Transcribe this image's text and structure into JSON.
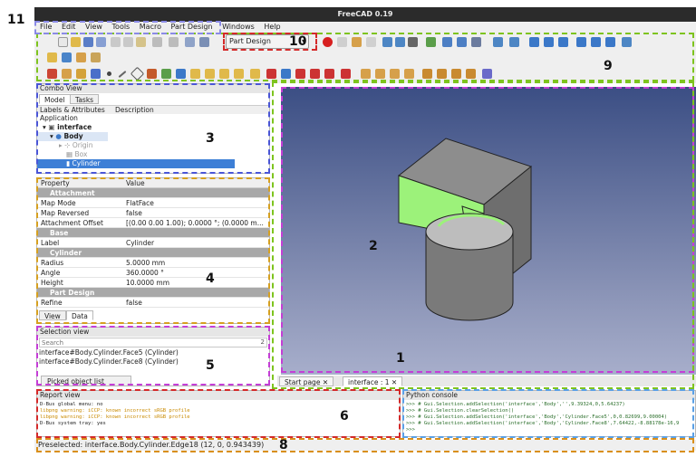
{
  "app_title": "FreeCAD 0.19",
  "menu": [
    "File",
    "Edit",
    "View",
    "Tools",
    "Macro",
    "Part Design",
    "Windows",
    "Help"
  ],
  "workbench": {
    "label": "Part Design"
  },
  "combo_view": {
    "title": "Combo View",
    "tabs": [
      "Model",
      "Tasks"
    ],
    "columns": [
      "Labels & Attributes",
      "Description"
    ],
    "tree": [
      {
        "label": "Application",
        "level": 0
      },
      {
        "label": "interface",
        "level": 1
      },
      {
        "label": "Body",
        "level": 2
      },
      {
        "label": "Origin",
        "level": 3
      },
      {
        "label": "Box",
        "level": 3
      },
      {
        "label": "Cylinder",
        "level": 3
      }
    ]
  },
  "property_view": {
    "headers": [
      "Property",
      "Value"
    ],
    "rows": [
      {
        "type": "group",
        "name": "Attachment"
      },
      {
        "name": "Map Mode",
        "value": "FlatFace"
      },
      {
        "name": "Map Reversed",
        "value": "false"
      },
      {
        "name": "Attachment Offset",
        "value": "[(0.00 0.00 1.00); 0.0000 °; (0.0000 m..."
      },
      {
        "type": "group",
        "name": "Base"
      },
      {
        "name": "Label",
        "value": "Cylinder"
      },
      {
        "type": "group",
        "name": "Cylinder"
      },
      {
        "name": "Radius",
        "value": "5.0000 mm"
      },
      {
        "name": "Angle",
        "value": "360.0000 °"
      },
      {
        "name": "Height",
        "value": "10.0000 mm"
      },
      {
        "type": "group",
        "name": "Part Design"
      },
      {
        "name": "Refine",
        "value": "false"
      }
    ],
    "tabs": [
      "View",
      "Data"
    ]
  },
  "selection_view": {
    "title": "Selection view",
    "search_placeholder": "Search",
    "count": "2",
    "items": [
      "interface#Body.Cylinder.Face5 (Cylinder)",
      "interface#Body.Cylinder.Face8 (Cylinder)"
    ],
    "picked_button": "Picked object list"
  },
  "doc_tabs": [
    "Start page",
    "interface : 1"
  ],
  "report_view": {
    "title": "Report view",
    "lines": [
      {
        "text": "D-Bus global menu: no",
        "color": "#222222"
      },
      {
        "text": "libpng warning: iCCP: known incorrect sRGB profile",
        "color": "#c98a00"
      },
      {
        "text": "libpng warning: iCCP: known incorrect sRGB profile",
        "color": "#c98a00"
      },
      {
        "text": "D-Bus system tray: yes",
        "color": "#222222"
      }
    ]
  },
  "python_console": {
    "title": "Python console",
    "lines": [
      ">>> # Gui.Selection.addSelection('interface','Body','',9.39324,0,5.64237)",
      ">>> # Gui.Selection.clearSelection()",
      ">>> # Gui.Selection.addSelection('interface','Body','Cylinder.Face5',0,0.82699,9.00004)",
      ">>> # Gui.Selection.addSelection('interface','Body','Cylinder.Face8',7.64422,-8.88178e-16,9",
      ">>>"
    ]
  },
  "status_bar": "Preselected: interface.Body.Cylinder.Edge18 (12, 0, 0.943439)",
  "annotations": [
    "1",
    "2",
    "3",
    "4",
    "5",
    "6",
    "8",
    "9",
    "10",
    "11"
  ],
  "colors": {
    "selection_green": "#9cf27a",
    "tree_selected": "#3d7fd6",
    "viewport_top": "#3b4e84",
    "viewport_bottom": "#a7aecb",
    "annot_blue": "#4a55d6",
    "annot_green": "#7ec41e",
    "annot_purple": "#c43ed6",
    "annot_red": "#d42a2a",
    "annot_orange": "#d98f1a",
    "annot_lightblue": "#5aa0e6"
  }
}
